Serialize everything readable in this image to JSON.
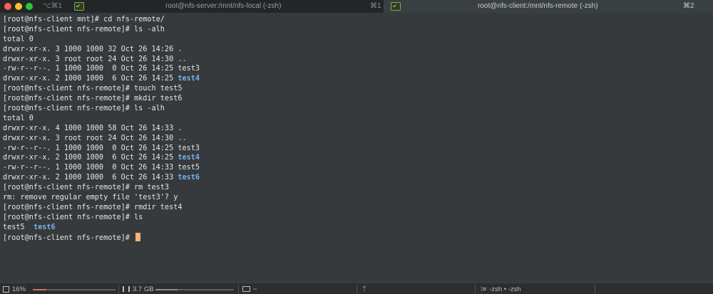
{
  "tabs": [
    {
      "shortcut_left": "⌥⌘1",
      "title": "root@nfs-server:/mnt/nfs-local (-zsh)",
      "shortcut": "⌘1",
      "active": false
    },
    {
      "title": "root@nfs-client:/mnt/nfs-remote (-zsh)",
      "shortcut": "⌘2",
      "active": true
    }
  ],
  "terminal": {
    "lines": [
      [
        {
          "t": "[root@nfs-client mnt]# cd nfs-remote/"
        }
      ],
      [
        {
          "t": "[root@nfs-client nfs-remote]# ls -alh"
        }
      ],
      [
        {
          "t": "total 0"
        }
      ],
      [
        {
          "t": "drwxr-xr-x. 3 1000 1000 32 Oct 26 14:26 ."
        }
      ],
      [
        {
          "t": "drwxr-xr-x. 3 root root 24 Oct 26 14:30 "
        },
        {
          "t": "..",
          "c": "blue"
        }
      ],
      [
        {
          "t": "-rw-r--r--. 1 1000 1000  0 Oct 26 14:25 test3"
        }
      ],
      [
        {
          "t": "drwxr-xr-x. 2 1000 1000  6 Oct 26 14:25 "
        },
        {
          "t": "test4",
          "c": "blue"
        }
      ],
      [
        {
          "t": "[root@nfs-client nfs-remote]# touch test5"
        }
      ],
      [
        {
          "t": "[root@nfs-client nfs-remote]# mkdir test6"
        }
      ],
      [
        {
          "t": "[root@nfs-client nfs-remote]# ls -alh"
        }
      ],
      [
        {
          "t": "total 0"
        }
      ],
      [
        {
          "t": "drwxr-xr-x. 4 1000 1000 58 Oct 26 14:33 ."
        }
      ],
      [
        {
          "t": "drwxr-xr-x. 3 root root 24 Oct 26 14:30 "
        },
        {
          "t": "..",
          "c": "blue"
        }
      ],
      [
        {
          "t": "-rw-r--r--. 1 1000 1000  0 Oct 26 14:25 test3"
        }
      ],
      [
        {
          "t": "drwxr-xr-x. 2 1000 1000  6 Oct 26 14:25 "
        },
        {
          "t": "test4",
          "c": "blue"
        }
      ],
      [
        {
          "t": "-rw-r--r--. 1 1000 1000  0 Oct 26 14:33 test5"
        }
      ],
      [
        {
          "t": "drwxr-xr-x. 2 1000 1000  6 Oct 26 14:33 "
        },
        {
          "t": "test6",
          "c": "blue"
        }
      ],
      [
        {
          "t": "[root@nfs-client nfs-remote]# rm test3"
        }
      ],
      [
        {
          "t": "rm: remove regular empty file 'test3'? y"
        }
      ],
      [
        {
          "t": "[root@nfs-client nfs-remote]# rmdir test4"
        }
      ],
      [
        {
          "t": "[root@nfs-client nfs-remote]# ls"
        }
      ],
      [
        {
          "t": "test5  "
        },
        {
          "t": "test6",
          "c": "blue"
        }
      ],
      [
        {
          "t": "[root@nfs-client nfs-remote]# "
        },
        {
          "cursor": true
        }
      ]
    ]
  },
  "statusbar": {
    "cpu": "16%",
    "cpu_usage_fraction": 0.16,
    "memory": "3.7 GB",
    "memory_usage_fraction": 0.28,
    "directory": "~",
    "jobs": "-zsh • -zsh"
  },
  "colors": {
    "directory_blue": "#74b1ec",
    "cursor": "#f2b27a",
    "traffic_red": "#fe5f57",
    "traffic_yellow": "#febc2e",
    "traffic_green": "#28c840"
  },
  "icons": [
    "terminal-icon",
    "cpu-icon",
    "memory-icon",
    "folder-icon",
    "git-branch-icon",
    "jobs-icon"
  ]
}
